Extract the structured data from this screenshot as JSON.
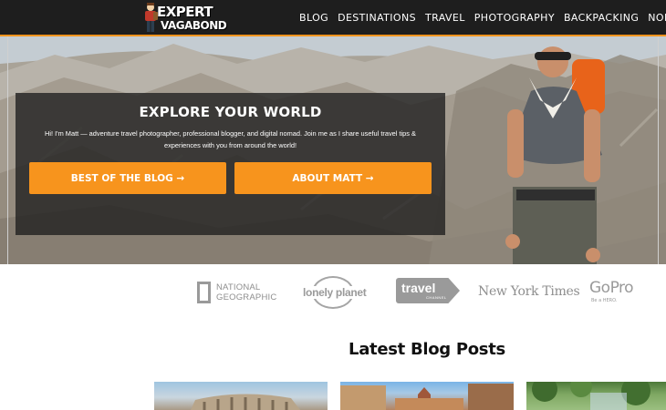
{
  "site": {
    "logo_line1": "EXPERT",
    "logo_line2": "VAGABOND",
    "accent_color": "#f7941d",
    "header_bg": "#1e1e1e"
  },
  "nav": {
    "items": [
      "BLOG",
      "DESTINATIONS",
      "TRAVEL",
      "PHOTOGRAPHY",
      "BACKPACKING",
      "NOMADIC"
    ]
  },
  "hero": {
    "title": "EXPLORE YOUR WORLD",
    "text": "Hi! I'm Matt — adventure travel photographer, professional blogger, and digital nomad. Join me as I share useful travel tips & experiences with you from around the world!",
    "button1_label": "BEST OF THE BLOG →",
    "button2_label": "ABOUT MATT →"
  },
  "press": {
    "national_geographic_line1": "NATIONAL",
    "national_geographic_line2": "GEOGRAPHIC",
    "lonely_planet": "lonely planet",
    "travel_channel": "travel",
    "travel_channel_sub": "CHANNEL",
    "nyt": "New York Times",
    "gopro": "GoPro",
    "gopro_sub": "Be a HERO."
  },
  "latest": {
    "title": "Latest Blog Posts"
  }
}
